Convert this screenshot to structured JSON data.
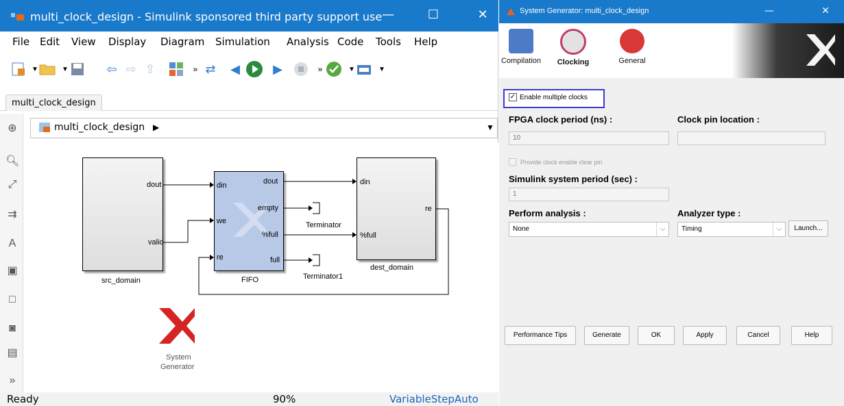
{
  "simulink": {
    "title": "multi_clock_design - Simulink sponsored third party support use",
    "menu": [
      "File",
      "Edit",
      "View",
      "Display",
      "Diagram",
      "Simulation",
      "Analysis",
      "Code",
      "Tools",
      "Help"
    ],
    "tab": "multi_clock_design",
    "address": "multi_clock_design",
    "status": {
      "left": "Ready",
      "zoom": "90%",
      "solver": "VariableStepAuto"
    },
    "blocks": {
      "src_domain": {
        "name": "src_domain",
        "ports": [
          "dout",
          "valid"
        ]
      },
      "fifo": {
        "name": "FIFO",
        "in_ports": [
          "din",
          "we",
          "re"
        ],
        "out_ports": [
          "dout",
          "empty",
          "%full",
          "full"
        ]
      },
      "terminator": "Terminator",
      "terminator1": "Terminator1",
      "dest_domain": {
        "name": "dest_domain",
        "in_ports": [
          "din",
          "%full"
        ],
        "out_ports": [
          "re"
        ]
      },
      "sysgen": [
        "System",
        "Generator"
      ]
    }
  },
  "sysgen_dialog": {
    "title": "System Generator: multi_clock_design",
    "tabs": [
      "Compilation",
      "Clocking",
      "General"
    ],
    "enable_multiple_clocks": "Enable multiple clocks",
    "fpga_clock_period_label": "FPGA clock period (ns) :",
    "fpga_clock_period_value": "10",
    "clock_pin_location_label": "Clock pin location :",
    "clock_pin_location_value": "",
    "provide_clock_enable": "Provide clock enable clear pin",
    "simulink_system_period_label": "Simulink system period (sec) :",
    "simulink_system_period_value": "1",
    "perform_analysis_label": "Perform analysis :",
    "perform_analysis_value": "None",
    "analyzer_type_label": "Analyzer type :",
    "analyzer_type_value": "Timing",
    "launch_button": "Launch...",
    "buttons": [
      "Performance Tips",
      "Generate",
      "OK",
      "Apply",
      "Cancel",
      "Help"
    ]
  },
  "colors": {
    "titlebar": "#1979ca",
    "fifo_fill": "#b8c9e8",
    "highlight": "#3b3bd1",
    "xilinx_red": "#d42424"
  }
}
